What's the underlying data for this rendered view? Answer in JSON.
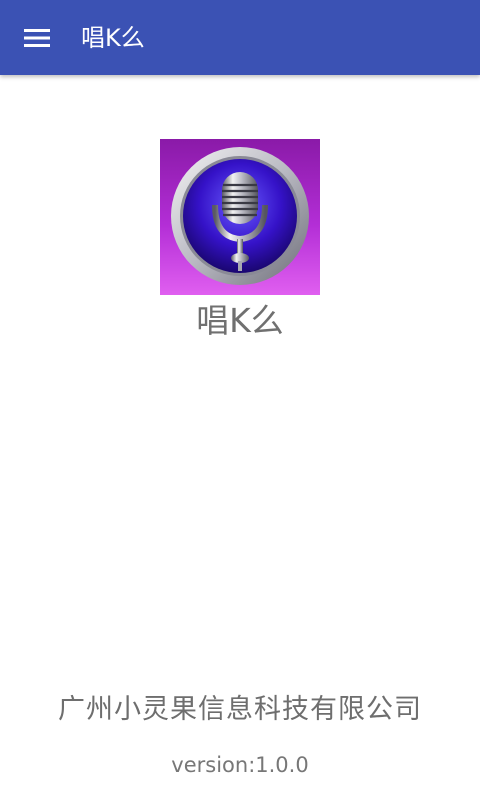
{
  "toolbar": {
    "title": "唱K么",
    "menu_icon": "hamburger-menu-icon",
    "background_color": "#3b52b4"
  },
  "about": {
    "app_icon": "microphone-icon",
    "app_name": "唱K么",
    "company": "广州小灵果信息科技有限公司",
    "version": "version:1.0.0"
  }
}
